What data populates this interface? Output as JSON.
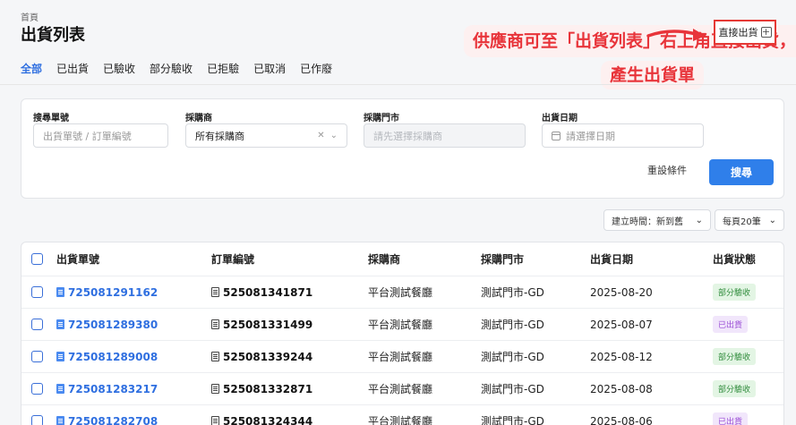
{
  "header": {
    "breadcrumb": "首頁",
    "title": "出貨列表",
    "direct_ship_label": "直接出貨",
    "direct_ship_icon": "plus-square-icon"
  },
  "annotation": {
    "line1": "供應商可至「出貨列表」右上角直接出貨，",
    "line2": "產生出貨單",
    "color": "#e8343a"
  },
  "tabs": [
    {
      "label": "全部",
      "active": true
    },
    {
      "label": "已出貨"
    },
    {
      "label": "已驗收"
    },
    {
      "label": "部分驗收"
    },
    {
      "label": "已拒驗"
    },
    {
      "label": "已取消"
    },
    {
      "label": "已作廢"
    }
  ],
  "filters": {
    "search_label": "搜尋單號",
    "search_placeholder": "出貨單號 / 訂單編號",
    "buyer_label": "採購商",
    "buyer_value": "所有採購商",
    "store_label": "採購門市",
    "store_placeholder": "請先選擇採購商",
    "date_label": "出貨日期",
    "date_placeholder": "請選擇日期",
    "reset_label": "重設條件",
    "search_button": "搜尋"
  },
  "sort": {
    "sort_value": "建立時間：新到舊",
    "page_size_value": "每頁20筆"
  },
  "table": {
    "columns": [
      "出貨單號",
      "訂單編號",
      "採購商",
      "採購門市",
      "出貨日期",
      "出貨狀態"
    ],
    "rows": [
      {
        "ship_no": "725081291162",
        "order_no": "525081341871",
        "buyer": "平台測試餐廳",
        "store": "測試門市-GD",
        "date": "2025-08-20",
        "status": "部分驗收",
        "status_type": "partial"
      },
      {
        "ship_no": "725081289380",
        "order_no": "525081331499",
        "buyer": "平台測試餐廳",
        "store": "測試門市-GD",
        "date": "2025-08-07",
        "status": "已出貨",
        "status_type": "shipped"
      },
      {
        "ship_no": "725081289008",
        "order_no": "525081339244",
        "buyer": "平台測試餐廳",
        "store": "測試門市-GD",
        "date": "2025-08-12",
        "status": "部分驗收",
        "status_type": "partial"
      },
      {
        "ship_no": "725081283217",
        "order_no": "525081332871",
        "buyer": "平台測試餐廳",
        "store": "測試門市-GD",
        "date": "2025-08-08",
        "status": "部分驗收",
        "status_type": "partial"
      },
      {
        "ship_no": "725081282708",
        "order_no": "525081324344",
        "buyer": "平台測試餐廳",
        "store": "測試門市-GD",
        "date": "2025-08-06",
        "status": "已出貨",
        "status_type": "shipped"
      }
    ]
  }
}
